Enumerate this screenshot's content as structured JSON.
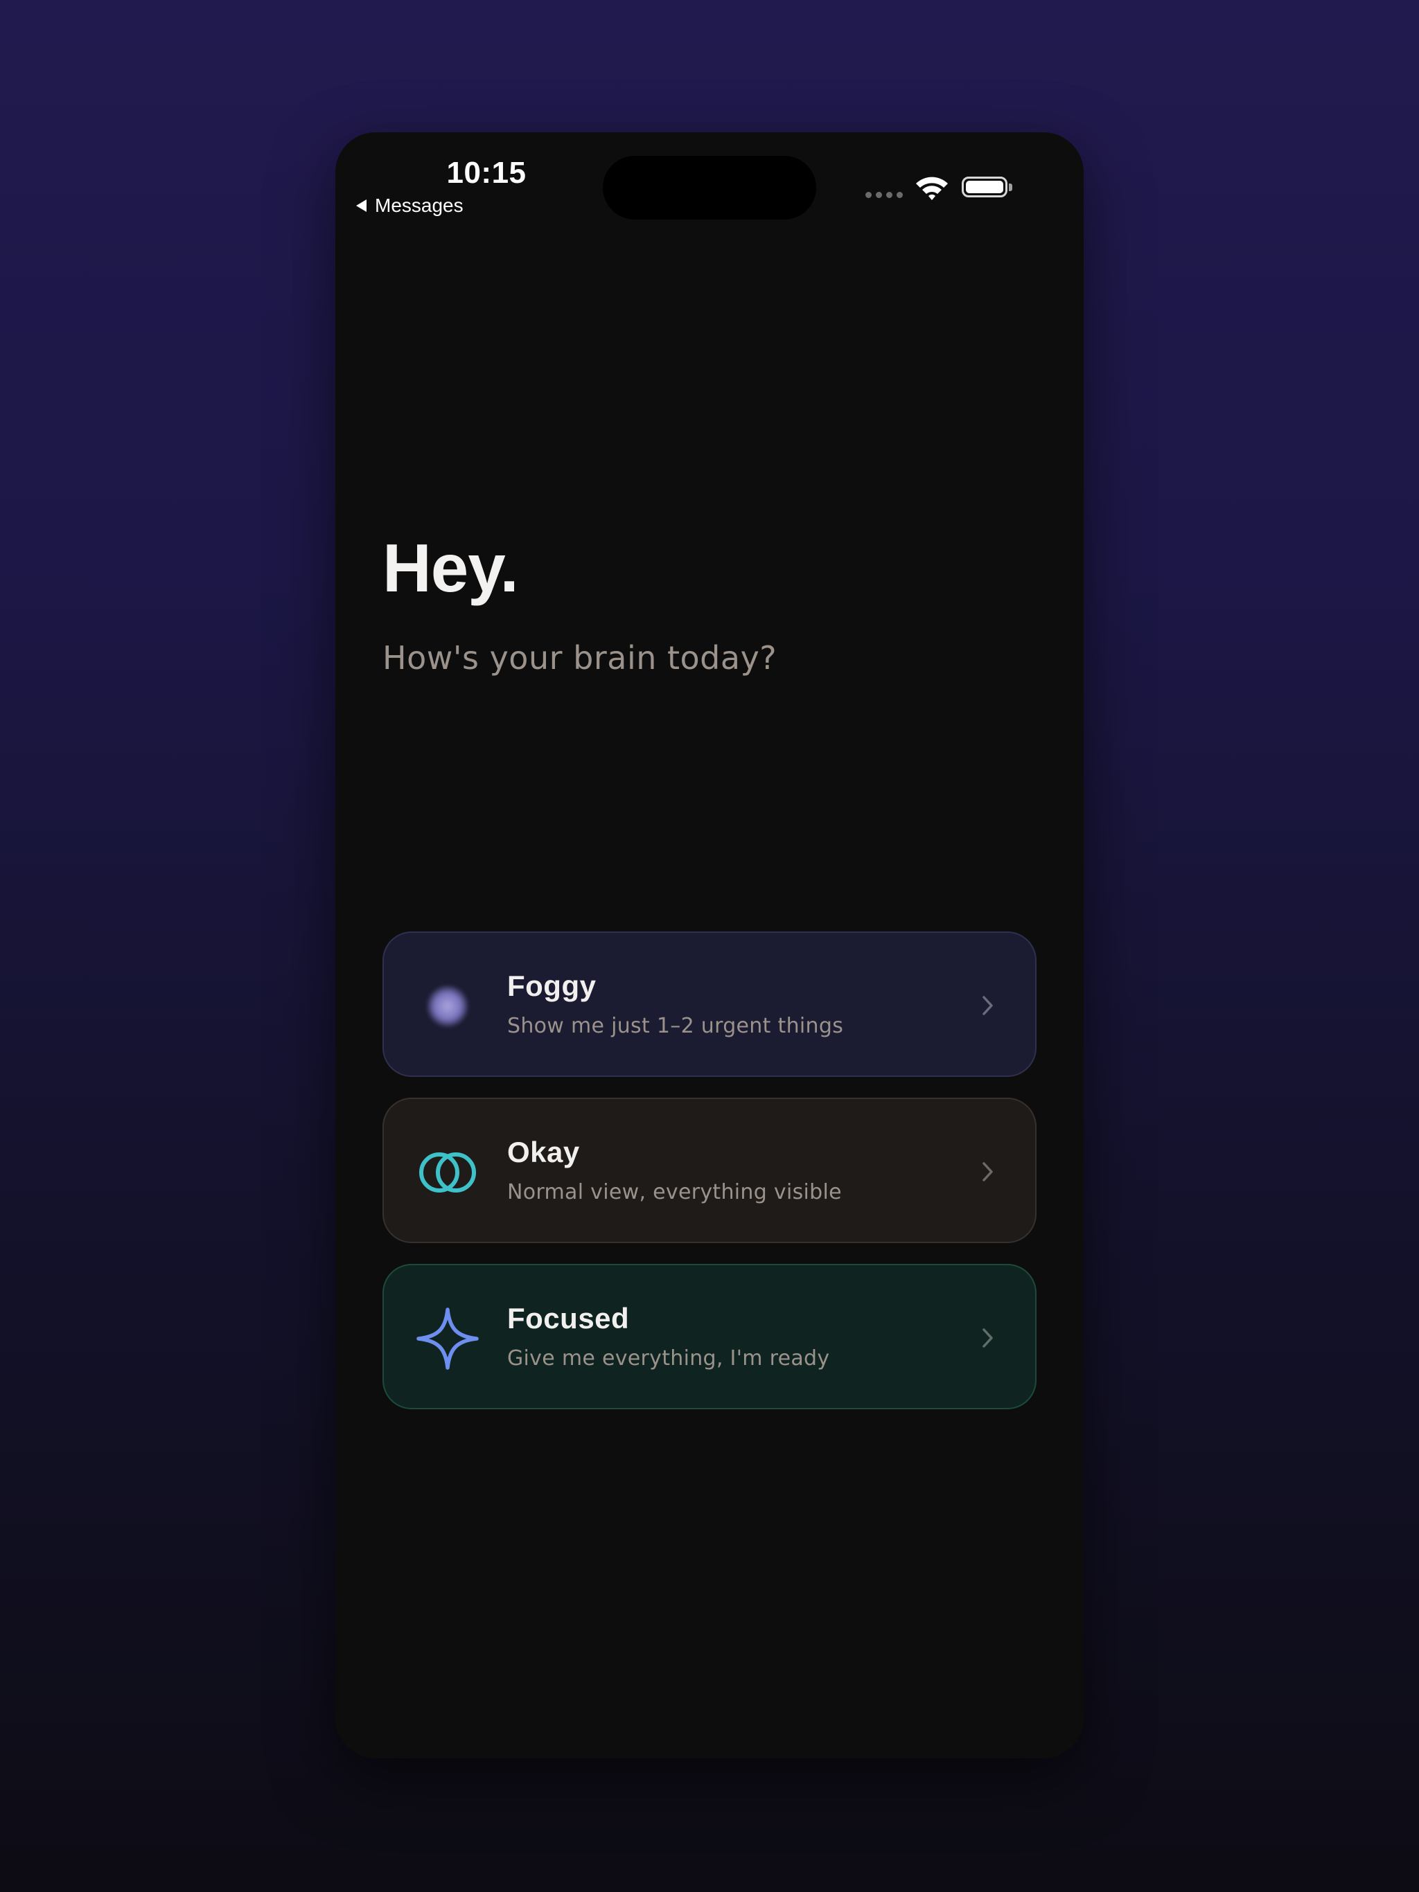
{
  "status_bar": {
    "time": "10:15",
    "back_label": "Messages"
  },
  "header": {
    "greeting": "Hey.",
    "prompt": "How's your brain today?"
  },
  "moods": [
    {
      "id": "foggy",
      "title": "Foggy",
      "description": "Show me just 1–2 urgent things",
      "icon": "fog-orb-icon",
      "accent": "#8f89cc"
    },
    {
      "id": "okay",
      "title": "Okay",
      "description": "Normal view, everything visible",
      "icon": "interlocked-rings-icon",
      "accent": "#3fc1c9"
    },
    {
      "id": "focused",
      "title": "Focused",
      "description": "Give me everything, I'm ready",
      "icon": "sparkle-star-icon",
      "accent": "#6e8ff0"
    }
  ]
}
